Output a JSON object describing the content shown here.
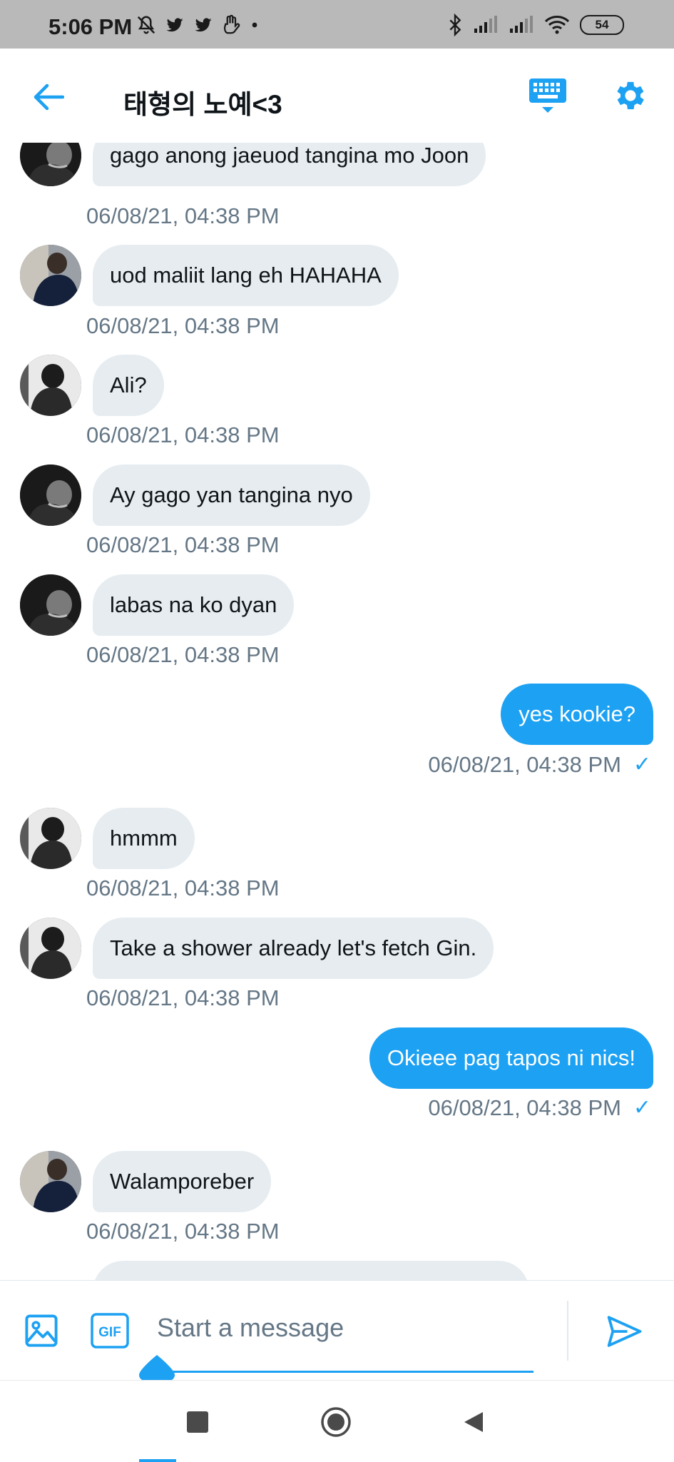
{
  "status_bar": {
    "time": "5:06 PM",
    "battery": "54",
    "icons_left": [
      "mute-icon",
      "twitter-icon",
      "twitter-icon",
      "hand-icon",
      "dot-icon"
    ],
    "icons_right": [
      "bluetooth-icon",
      "signal-icon",
      "signal-icon",
      "wifi-icon",
      "battery-icon"
    ]
  },
  "header": {
    "title": "태형의 노예<3",
    "back_icon": "back-arrow-icon",
    "keyboard_icon": "keyboard-icon",
    "settings_icon": "gear-icon",
    "accent_color": "#1da1f2"
  },
  "messages": [
    {
      "direction": "in",
      "text": "gago anong jaeuod tangina mo Joon",
      "timestamp": "06/08/21, 04:38 PM",
      "avatar": "dark"
    },
    {
      "direction": "in",
      "text": "uod maliit lang eh HAHAHA",
      "timestamp": "06/08/21, 04:38 PM",
      "avatar": "navy"
    },
    {
      "direction": "in",
      "text": "Ali?",
      "timestamp": "06/08/21, 04:38 PM",
      "avatar": "mono"
    },
    {
      "direction": "in",
      "text": "Ay gago yan tangina nyo",
      "timestamp": "06/08/21, 04:38 PM",
      "avatar": "dark"
    },
    {
      "direction": "in",
      "text": "labas na ko dyan",
      "timestamp": "06/08/21, 04:38 PM",
      "avatar": "dark"
    },
    {
      "direction": "out",
      "text": "yes kookie?",
      "timestamp": "06/08/21, 04:38 PM"
    },
    {
      "direction": "in",
      "text": "hmmm",
      "timestamp": "06/08/21, 04:38 PM",
      "avatar": "mono"
    },
    {
      "direction": "in",
      "text": "Take a shower already let's fetch Gin.",
      "timestamp": "06/08/21, 04:38 PM",
      "avatar": "mono"
    },
    {
      "direction": "out",
      "text": "Okieee pag tapos ni nics!",
      "timestamp": "06/08/21, 04:38 PM"
    },
    {
      "direction": "in",
      "text": "Walamporeber",
      "timestamp": "06/08/21, 04:38 PM",
      "avatar": "navy"
    }
  ],
  "composer": {
    "placeholder": "Start a message",
    "gif_label": "GIF"
  },
  "colors": {
    "accent": "#1da1f2",
    "incoming_bubble": "#e6ecf0",
    "timestamp": "#657786"
  }
}
